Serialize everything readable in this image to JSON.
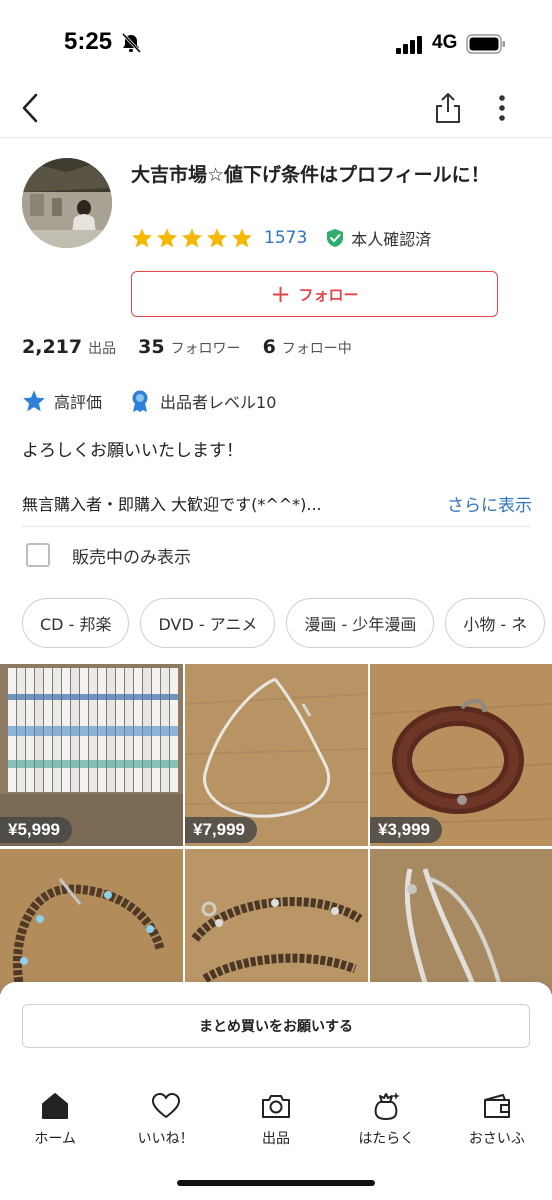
{
  "status_bar": {
    "time": "5:25",
    "network": "4G"
  },
  "nav": {
    "back_icon": "chevron-left-icon",
    "share_icon": "share-icon",
    "more_icon": "more-vertical-icon"
  },
  "profile": {
    "shop_name": "大吉市場☆値下げ条件はプロフィールに！",
    "rating_count": "1573",
    "rating_stars": 5,
    "verified_label": "本人確認済",
    "follow_label": "フォロー",
    "follow_icon": "+"
  },
  "stats": [
    {
      "value": "2,217",
      "label": "出品"
    },
    {
      "value": "35",
      "label": "フォロワー"
    },
    {
      "value": "6",
      "label": "フォロー中"
    }
  ],
  "badges": [
    {
      "icon": "star-icon",
      "label": "高評価"
    },
    {
      "icon": "medal-icon",
      "label": "出品者レベル10"
    }
  ],
  "bio": {
    "greeting": "よろしくお願いいたします！",
    "excerpt": "無言購入者・即購入 大歓迎です(*^^*)...",
    "more_label": "さらに表示"
  },
  "filter": {
    "onsale_only_label": "販売中のみ表示",
    "checked": false
  },
  "categories": [
    "CD - 邦楽",
    "DVD - アニメ",
    "漫画 - 少年漫画",
    "小物 - ネ"
  ],
  "items": [
    {
      "price": "¥5,999",
      "image": "dvd-set"
    },
    {
      "price": "¥7,999",
      "image": "silver-chain-necklace"
    },
    {
      "price": "¥3,999",
      "image": "leather-bracelet"
    },
    {
      "price": "",
      "image": "beaded-necklace"
    },
    {
      "price": "",
      "image": "beaded-necklace"
    },
    {
      "price": "",
      "image": "silver-chain-necklace"
    }
  ],
  "bottom_sheet": {
    "bundle_label": "まとめ買いをお願いする"
  },
  "tabs": [
    {
      "label": "ホーム",
      "icon": "home-icon"
    },
    {
      "label": "いいね！",
      "icon": "heart-icon"
    },
    {
      "label": "出品",
      "icon": "camera-icon"
    },
    {
      "label": "はたらく",
      "icon": "bag-icon"
    },
    {
      "label": "おさいふ",
      "icon": "wallet-icon"
    }
  ],
  "colors": {
    "accent": "#e6454a",
    "link": "#2f74c0",
    "star": "#f5b700",
    "verified": "#2eae6b"
  }
}
